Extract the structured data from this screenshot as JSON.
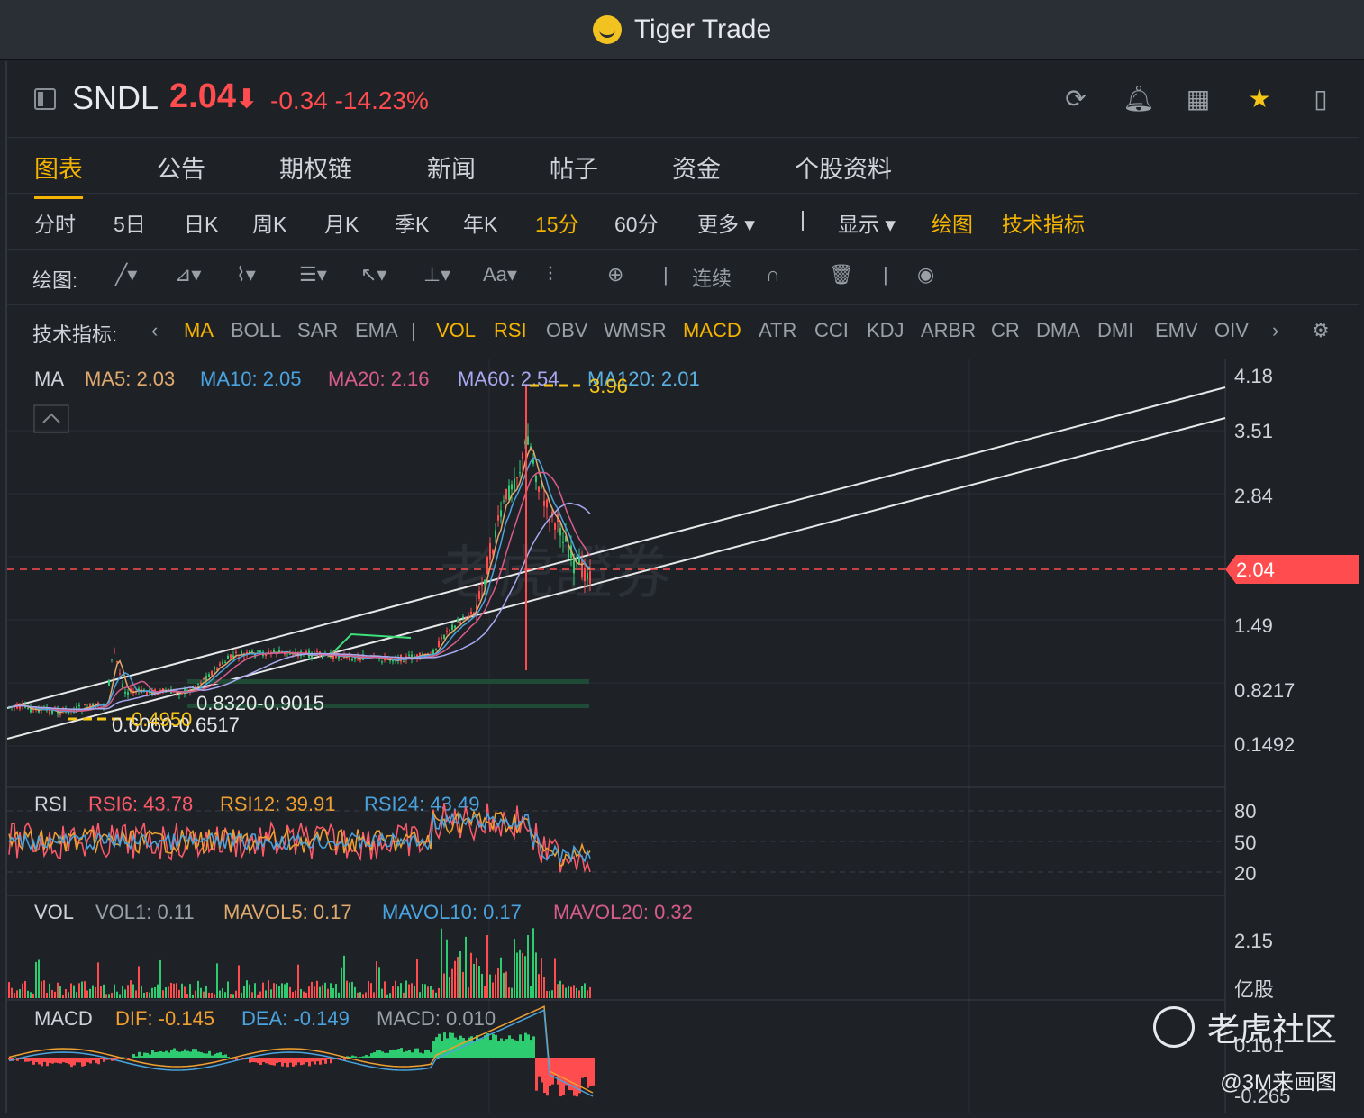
{
  "window": {
    "title": "Tiger Trade"
  },
  "quote": {
    "symbol": "SNDL",
    "price": "2.04",
    "arrow": "⬇",
    "change": "-0.34",
    "change_pct": "-14.23%"
  },
  "header_icons": [
    "refresh-icon",
    "bell-icon",
    "grid-icon",
    "star-icon",
    "panel-icon"
  ],
  "tabs": [
    "图表",
    "公告",
    "期权链",
    "新闻",
    "帖子",
    "资金",
    "个股资料"
  ],
  "periods": [
    "分时",
    "5日",
    "日K",
    "周K",
    "月K",
    "季K",
    "年K",
    "15分",
    "60分",
    "更多 ▾",
    "|",
    "显示 ▾",
    "绘图",
    "技术指标"
  ],
  "draw": {
    "label": "绘图:",
    "continuous": "连续"
  },
  "indicators": {
    "label": "技术指标:",
    "items": [
      "MA",
      "BOLL",
      "SAR",
      "EMA",
      "|",
      "VOL",
      "RSI",
      "OBV",
      "WMSR",
      "MACD",
      "ATR",
      "CCI",
      "KDJ",
      "ARBR",
      "CR",
      "DMA",
      "DMI",
      "EMV",
      "OIV"
    ]
  },
  "ma_legend": {
    "name": "MA",
    "ma5": "MA5: 2.03",
    "ma10": "MA10: 2.05",
    "ma20": "MA20: 2.16",
    "ma60": "MA60: 2.54",
    "ma120": "MA120: 2.01"
  },
  "price_axis": [
    "4.18",
    "3.51",
    "2.84",
    "2.17",
    "1.49",
    "0.8217",
    "0.1492"
  ],
  "current_price_tag": "2.04",
  "annotations": {
    "high": "3.96",
    "low": "0.4950",
    "range1": "0.8320-0.9015",
    "range2": "0.6060-0.6517"
  },
  "rsi_legend": {
    "name": "RSI",
    "rsi6": "RSI6: 43.78",
    "rsi12": "RSI12: 39.91",
    "rsi24": "RSI24: 43.49"
  },
  "rsi_axis": [
    "80",
    "50",
    "20"
  ],
  "vol_legend": {
    "name": "VOL",
    "vol1": "VOL1: 0.11",
    "mavol5": "MAVOL5: 0.17",
    "mavol10": "MAVOL10: 0.17",
    "mavol20": "MAVOL20: 0.32"
  },
  "vol_axis": [
    "2.15",
    "亿股"
  ],
  "macd_legend": {
    "name": "MACD",
    "dif": "DIF: -0.145",
    "dea": "DEA: -0.149",
    "macd": "MACD: 0.010"
  },
  "macd_axis": [
    "0.101",
    "-0.265"
  ],
  "watermark": {
    "brand": "老虎社区",
    "author": "@3M来画图",
    "bg": "老虎證券"
  },
  "colors": {
    "up": "#ff4d4f",
    "down": "#2ecc71",
    "accent": "#f5b400",
    "ma5": "#e0a96d",
    "ma10": "#4aa3df",
    "ma20": "#d85c8a",
    "ma60": "#a8a8f0",
    "ma120": "#5ab0e0"
  }
}
